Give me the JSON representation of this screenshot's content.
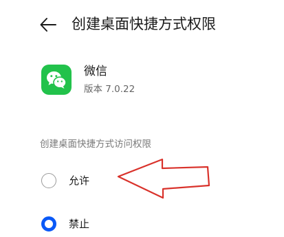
{
  "header": {
    "title": "创建桌面快捷方式权限",
    "back_icon": "arrow-left-icon"
  },
  "app": {
    "name": "微信",
    "version": "版本 7.0.22",
    "icon": "wechat-icon",
    "icon_color": "#22c24b"
  },
  "section": {
    "title": "创建桌面快捷方式访问权限"
  },
  "options": [
    {
      "label": "允许",
      "selected": false
    },
    {
      "label": "禁止",
      "selected": true
    }
  ],
  "colors": {
    "accent": "#0a59f7",
    "annotation_arrow": "#d9322b"
  }
}
